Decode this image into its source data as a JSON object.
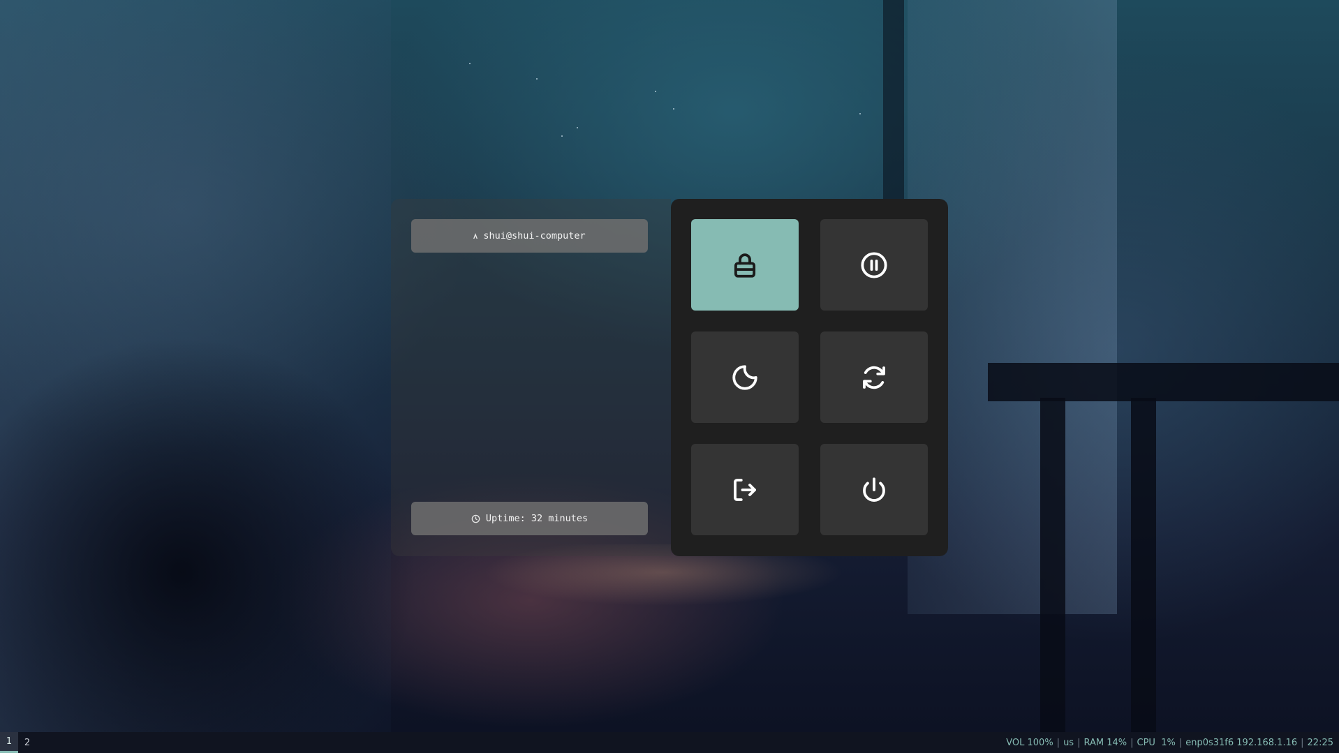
{
  "power_menu": {
    "user": {
      "label": "shui@shui-computer",
      "icon": "arch-icon"
    },
    "uptime": {
      "label": "Uptime: 32 minutes",
      "icon": "clock-icon"
    },
    "actions": [
      {
        "name": "lock",
        "icon": "lock-icon",
        "selected": true
      },
      {
        "name": "suspend",
        "icon": "pause-circle-icon",
        "selected": false
      },
      {
        "name": "sleep",
        "icon": "moon-icon",
        "selected": false
      },
      {
        "name": "reboot",
        "icon": "refresh-icon",
        "selected": false
      },
      {
        "name": "logout",
        "icon": "logout-icon",
        "selected": false
      },
      {
        "name": "shutdown",
        "icon": "power-icon",
        "selected": false
      }
    ],
    "colors": {
      "accent": "#86bbb3",
      "button_bg": "#343434",
      "panel_bg": "#1f1f1f"
    }
  },
  "statusbar": {
    "workspaces": [
      {
        "label": "1",
        "active": true
      },
      {
        "label": "2",
        "active": false
      }
    ],
    "modules": {
      "volume": "VOL 100%",
      "layout": "us",
      "ram": "RAM 14%",
      "cpu": "CPU  1%",
      "network": "enp0s31f6 192.168.1.16",
      "clock": "22:25"
    }
  }
}
